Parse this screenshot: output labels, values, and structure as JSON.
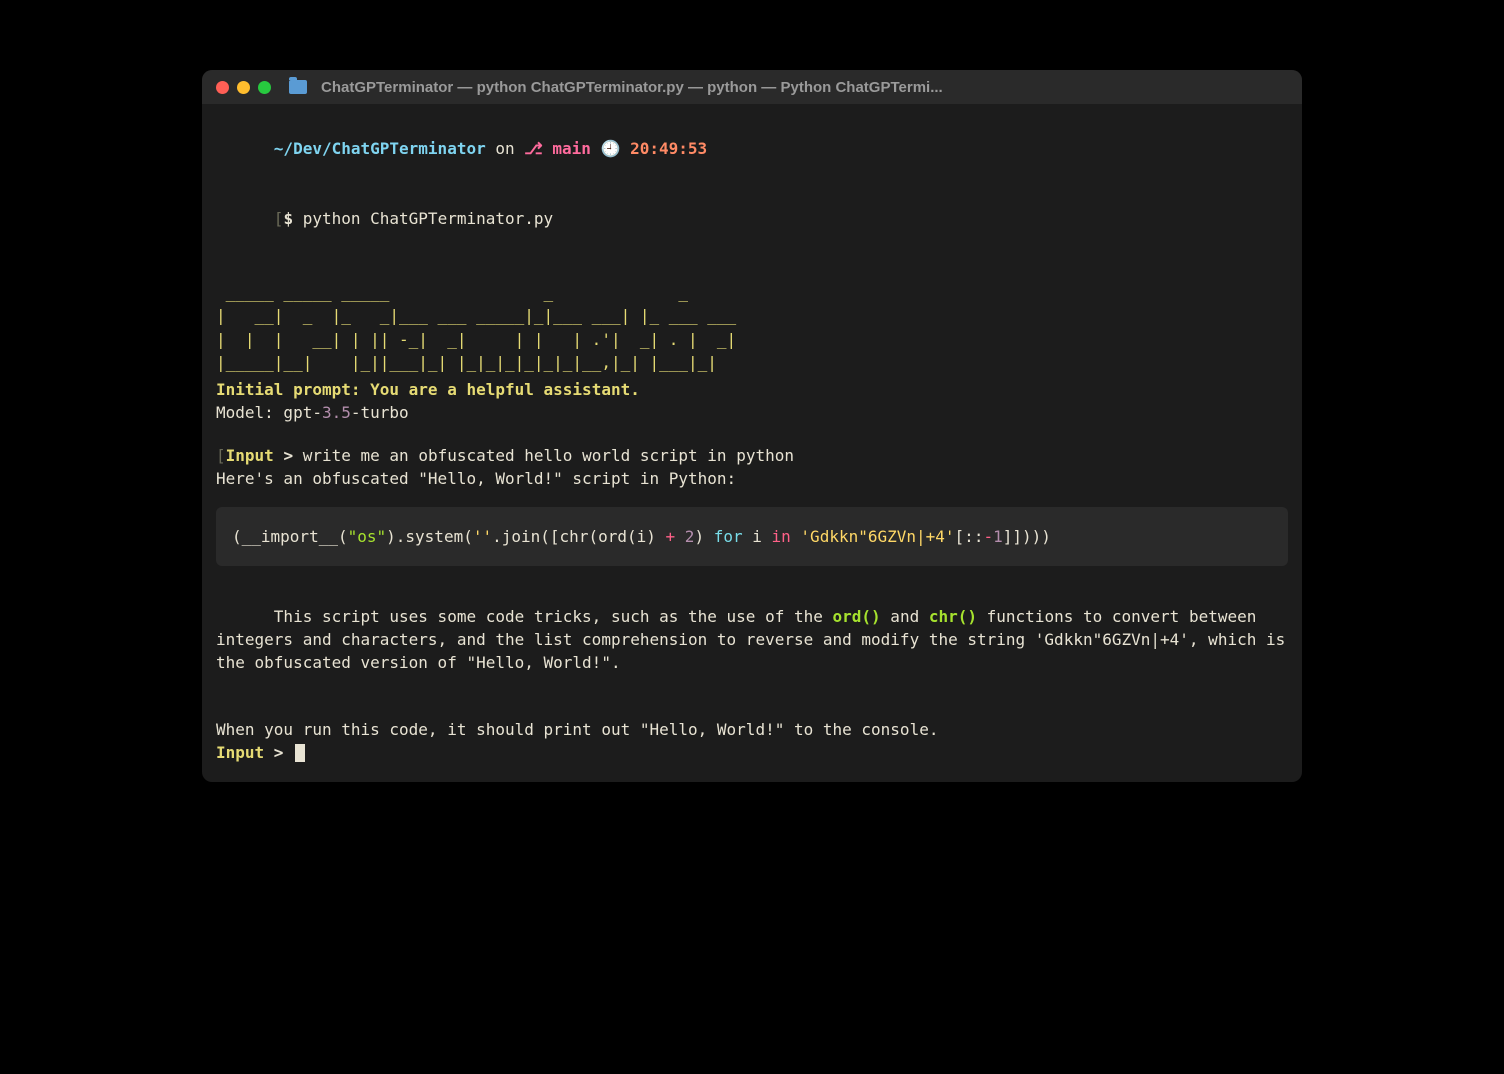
{
  "window": {
    "title": "ChatGPTerminator — python ChatGPTerminator.py — python — Python ChatGPTermi..."
  },
  "prompt": {
    "path": "~/Dev/ChatGPTerminator",
    "on": " on ",
    "branch": "main",
    "time": "20:49:53",
    "bracket_open": "[",
    "bracket_close": "]",
    "dollar": "$ ",
    "command": "python ChatGPTerminator.py"
  },
  "ascii": " _____ _____ _____                _             _\n|   __|  _  |_   _|___ ___ _____|_|___ ___| |_ ___ ___\n|  |  |   __| | || -_|  _|     | |   | .'|  _| . |  _|\n|_____|__|    |_||___|_| |_|_|_|_|_|_|__,|_| |___|_|",
  "initprompt": {
    "label": "Initial prompt:",
    "text": " You are a helpful assistant."
  },
  "model": {
    "prefix": "Model: gpt-",
    "num": "3.5",
    "suffix": "-turbo"
  },
  "exchange": {
    "input_label": "Input",
    "arrow": " > ",
    "user1": "write me an obfuscated hello world script in python",
    "intro": "Here's an obfuscated \"Hello, World!\" script in Python:",
    "explain_pre": "This script uses some code tricks, such as the use of the ",
    "fn1": "ord()",
    "explain_mid1": " and ",
    "fn2": "chr()",
    "explain_mid2": " functions to convert between integers and characters, and the list comprehension to reverse and modify the string 'Gdkkn\"6GZVn|+4', which is the obfuscated version of \"Hello, World!\".",
    "explain_p2": "When you run this code, it should print out \"Hello, World!\" to the console."
  },
  "code": {
    "t1": "(__import__(",
    "s1": "\"os\"",
    "t2": ")",
    "dot1": ".",
    "t3": "system(",
    "s2": "''",
    "dot2": ".",
    "t4": "join([chr(ord(i) ",
    "op_plus": "+",
    "sp1": " ",
    "n1": "2",
    "t5": ") ",
    "kw_for": "for",
    "sp2": " i ",
    "kw_in": "in",
    "sp3": " ",
    "s3": "'Gdkkn\"6GZVn|+4'",
    "t6": "[::",
    "op_neg": "-",
    "n2": "1",
    "t7": "]])))"
  }
}
